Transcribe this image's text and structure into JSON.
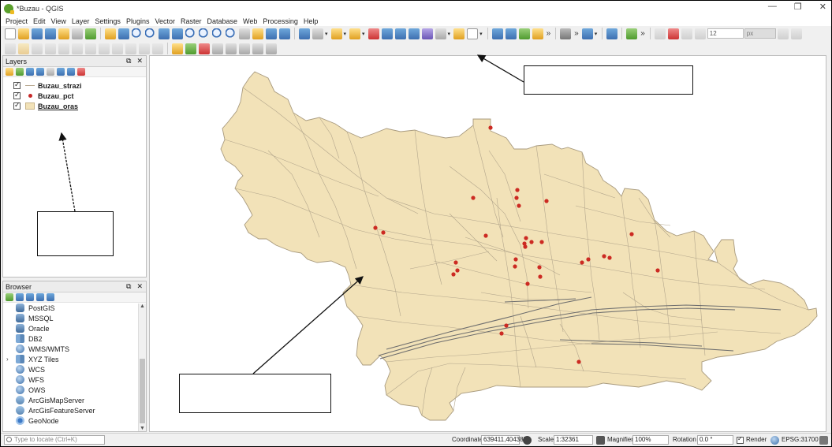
{
  "window": {
    "title": "*Buzau - QGIS",
    "controls": {
      "minimize": "—",
      "restore": "❐",
      "close": "✕"
    }
  },
  "menu": [
    "Project",
    "Edit",
    "View",
    "Layer",
    "Settings",
    "Plugins",
    "Vector",
    "Raster",
    "Database",
    "Web",
    "Processing",
    "Help"
  ],
  "toolbar": {
    "snapping_tolerance": "12",
    "snapping_units": "px",
    "overflow": "»"
  },
  "layers_panel": {
    "title": "Layers",
    "layers": [
      {
        "name": "Buzau_strazi",
        "symbol": "line",
        "checked": true
      },
      {
        "name": "Buzau_pct",
        "symbol": "point",
        "checked": true
      },
      {
        "name": "Buzau_oras",
        "symbol": "polygon",
        "checked": true,
        "active": true
      }
    ]
  },
  "browser_panel": {
    "title": "Browser",
    "items": [
      {
        "label": "PostGIS",
        "icon": "postgis-icon"
      },
      {
        "label": "MSSQL",
        "icon": "mssql-icon"
      },
      {
        "label": "Oracle",
        "icon": "oracle-icon"
      },
      {
        "label": "DB2",
        "icon": "db2-icon"
      },
      {
        "label": "WMS/WMTS",
        "icon": "wms-icon"
      },
      {
        "label": "XYZ Tiles",
        "icon": "xyz-tiles-icon",
        "expandable": true
      },
      {
        "label": "WCS",
        "icon": "wcs-icon"
      },
      {
        "label": "WFS",
        "icon": "wfs-icon"
      },
      {
        "label": "OWS",
        "icon": "ows-icon"
      },
      {
        "label": "ArcGisMapServer",
        "icon": "arcgis-map-server-icon"
      },
      {
        "label": "ArcGisFeatureServer",
        "icon": "arcgis-feature-server-icon"
      },
      {
        "label": "GeoNode",
        "icon": "geonode-icon"
      }
    ]
  },
  "map": {
    "polygon_fill": "#f2e2b8",
    "polygon_stroke": "#a89a7e",
    "street_color": "#b3a68c",
    "point_color": "#cc2a22",
    "rail_color": "#6e6e6e"
  },
  "statusbar": {
    "locate_placeholder": "Type to locate (Ctrl+K)",
    "coordinate_label": "Coordinate",
    "coordinate_value": "639411,404385",
    "scale_label": "Scale",
    "scale_value": "1:32361",
    "magnifier_label": "Magnifier",
    "magnifier_value": "100%",
    "rotation_label": "Rotation",
    "rotation_value": "0.0 °",
    "render_label": "Render",
    "crs_value": "EPSG:31700"
  }
}
